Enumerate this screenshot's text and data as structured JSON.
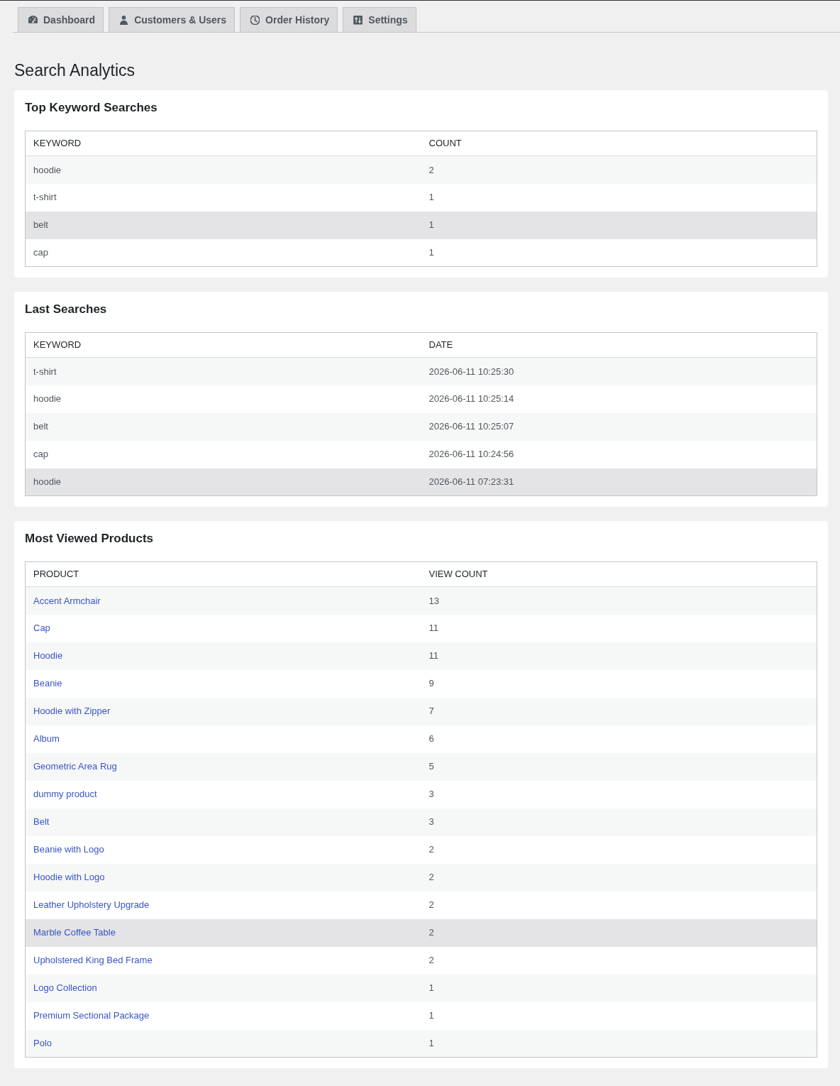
{
  "tabs": [
    {
      "label": "Dashboard",
      "kind": "dashboard",
      "selected": false
    },
    {
      "label": "Customers & Users",
      "kind": "users",
      "selected": false
    },
    {
      "label": "Order History",
      "kind": "history",
      "selected": false
    },
    {
      "label": "Settings",
      "kind": "settings",
      "selected": false
    }
  ],
  "page_title": "Search Analytics",
  "sections": [
    {
      "title": "Top Keyword Searches",
      "table": {
        "columns": [
          {
            "label": "KEYWORD",
            "kind": "text"
          },
          {
            "label": "COUNT",
            "kind": "text"
          }
        ],
        "rows": [
          {
            "cells": [
              "hoodie",
              "2"
            ],
            "highlighted": false
          },
          {
            "cells": [
              "t-shirt",
              "1"
            ],
            "highlighted": false
          },
          {
            "cells": [
              "belt",
              "1"
            ],
            "highlighted": true
          },
          {
            "cells": [
              "cap",
              "1"
            ],
            "highlighted": false
          }
        ]
      }
    },
    {
      "title": "Last Searches",
      "table": {
        "columns": [
          {
            "label": "KEYWORD",
            "kind": "text"
          },
          {
            "label": "DATE",
            "kind": "text"
          }
        ],
        "rows": [
          {
            "cells": [
              "t-shirt",
              "2026-06-11 10:25:30"
            ],
            "highlighted": false
          },
          {
            "cells": [
              "hoodie",
              "2026-06-11 10:25:14"
            ],
            "highlighted": false
          },
          {
            "cells": [
              "belt",
              "2026-06-11 10:25:07"
            ],
            "highlighted": false
          },
          {
            "cells": [
              "cap",
              "2026-06-11 10:24:56"
            ],
            "highlighted": false
          },
          {
            "cells": [
              "hoodie",
              "2026-06-11 07:23:31"
            ],
            "highlighted": true
          }
        ]
      }
    },
    {
      "title": "Most Viewed Products",
      "table": {
        "columns": [
          {
            "label": "PRODUCT",
            "kind": "link"
          },
          {
            "label": "VIEW COUNT",
            "kind": "text"
          }
        ],
        "rows": [
          {
            "cells": [
              "Accent Armchair",
              "13"
            ],
            "highlighted": false
          },
          {
            "cells": [
              "Cap",
              "11"
            ],
            "highlighted": false
          },
          {
            "cells": [
              "Hoodie",
              "11"
            ],
            "highlighted": false
          },
          {
            "cells": [
              "Beanie",
              "9"
            ],
            "highlighted": false
          },
          {
            "cells": [
              "Hoodie with Zipper",
              "7"
            ],
            "highlighted": false
          },
          {
            "cells": [
              "Album",
              "6"
            ],
            "highlighted": false
          },
          {
            "cells": [
              "Geometric Area Rug",
              "5"
            ],
            "highlighted": false
          },
          {
            "cells": [
              "dummy product",
              "3"
            ],
            "highlighted": false
          },
          {
            "cells": [
              "Belt",
              "3"
            ],
            "highlighted": false
          },
          {
            "cells": [
              "Beanie with Logo",
              "2"
            ],
            "highlighted": false
          },
          {
            "cells": [
              "Hoodie with Logo",
              "2"
            ],
            "highlighted": false
          },
          {
            "cells": [
              "Leather Upholstery Upgrade",
              "2"
            ],
            "highlighted": false
          },
          {
            "cells": [
              "Marble Coffee Table",
              "2"
            ],
            "highlighted": true
          },
          {
            "cells": [
              "Upholstered King Bed Frame",
              "2"
            ],
            "highlighted": false
          },
          {
            "cells": [
              "Logo Collection",
              "1"
            ],
            "highlighted": false
          },
          {
            "cells": [
              "Premium Sectional Package",
              "1"
            ],
            "highlighted": false
          },
          {
            "cells": [
              "Polo",
              "1"
            ],
            "highlighted": false
          }
        ]
      }
    }
  ]
}
